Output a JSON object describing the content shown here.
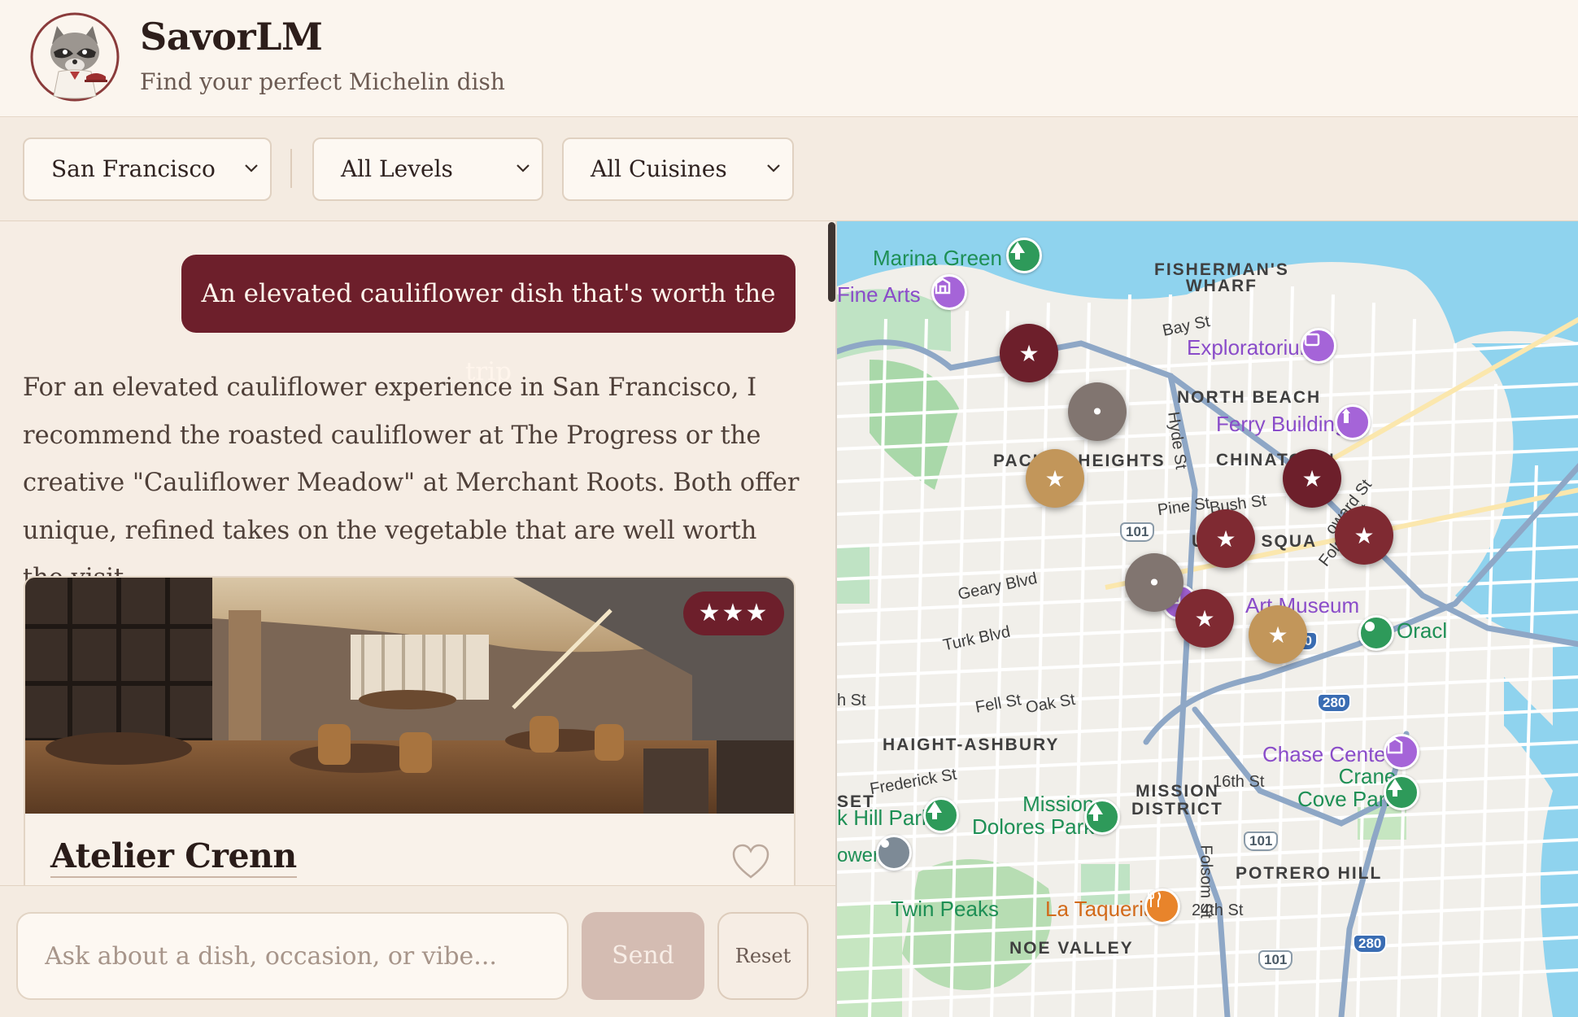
{
  "header": {
    "brand_name": "SavorLM",
    "tagline": "Find your perfect Michelin dish",
    "logo_icon": "raccoon-chef-logo"
  },
  "filters": {
    "city": "San Francisco",
    "level": "All Levels",
    "cuisine": "All Cuisines"
  },
  "chat": {
    "user_message": "An elevated cauliflower dish that's worth the trip",
    "assistant_reply": "For an elevated cauliflower experience in San Francisco, I recommend the roasted cauliflower at The Progress or the creative \"Cauliflower Meadow\" at Merchant Roots. Both offer unique, refined takes on the vegetable that are well worth the visit.",
    "card": {
      "restaurant_name": "Atelier Crenn",
      "stars": "★★★"
    }
  },
  "composer": {
    "placeholder": "Ask about a dish, occasion, or vibe...",
    "send_label": "Send",
    "reset_label": "Reset"
  },
  "map": {
    "places": {
      "marina_green": "Marina Green",
      "fine_arts": "Fine Arts",
      "exploratorium": "Exploratorium",
      "ferry_building": "Ferry Building",
      "art_museum": "Art Museum",
      "oracle": "Oracl",
      "chase_center": "Chase Center",
      "crane_cove": "Crane\nCove Park",
      "mission_dolores": "Mission\nDolores Park",
      "hill_park": "k Hill Park",
      "twin_peaks": "Twin Peaks",
      "la_taqueria": "La Taqueria",
      "tower": "ower"
    },
    "districts": {
      "fishermans_wharf": "FISHERMAN'S\nWHARF",
      "north_beach": "NORTH BEACH",
      "pacific_heights": "PACIFIC HEIGHTS",
      "chinatown": "CHINATOWN",
      "union_square": "UNION SQUA",
      "haight_ashbury": "HAIGHT-ASHBURY",
      "mission_district": "MISSION\nDISTRICT",
      "potrero_hill": "POTRERO HILL",
      "noe_valley": "NOE VALLEY",
      "sunset": "SET"
    },
    "streets": {
      "bay": "Bay St",
      "hyde": "Hyde St",
      "pine": "Pine St",
      "bush": "Bush St",
      "howard": "oward St",
      "folsom_ne": "Folsom St",
      "geary": "Geary Blvd",
      "turk": "Turk Blvd",
      "fell": "Fell St",
      "oak": "Oak St",
      "h_st": "h St",
      "frederick": "Frederick St",
      "sixteenth": "16th St",
      "folsom": "Folsom St",
      "twentyfourth": "24th St"
    },
    "highways": {
      "us101_a": "101",
      "us101_b": "101",
      "us101_c": "101",
      "i80": "80",
      "i280_a": "280",
      "i280_b": "280"
    },
    "markers": [
      {
        "label": "★",
        "tier": "one-star"
      },
      {
        "label": "•",
        "tier": "recommended"
      },
      {
        "label": "★",
        "tier": "bib"
      },
      {
        "label": "★",
        "tier": "one-star"
      },
      {
        "label": "★",
        "tier": "one-star"
      },
      {
        "label": "★",
        "tier": "one-star"
      },
      {
        "label": "•",
        "tier": "recommended"
      },
      {
        "label": "★",
        "tier": "one-star"
      },
      {
        "label": "★",
        "tier": "bib"
      }
    ]
  },
  "colors": {
    "brand": "#6d1f2b",
    "background": "#f6ede4",
    "gold": "#c2965a"
  }
}
